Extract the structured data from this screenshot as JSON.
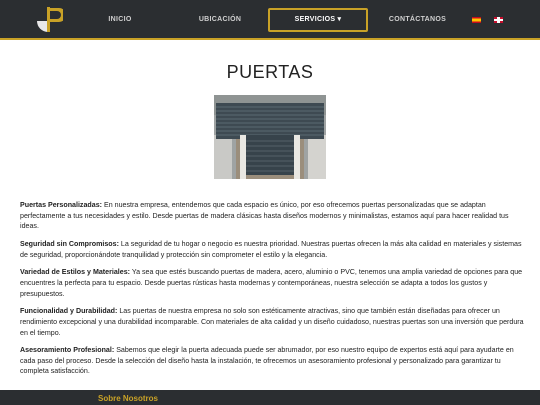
{
  "nav": {
    "inicio": "INICIO",
    "ubicacion": "UBICACIÓN",
    "servicios": "SERVICIOS ▾",
    "contactanos": "CONTÁCTANOS"
  },
  "page": {
    "title": "PUERTAS"
  },
  "sections": [
    {
      "heading": "Puertas Personalizadas:",
      "text": " En nuestra empresa, entendemos que cada espacio es único, por eso ofrecemos puertas personalizadas que se adaptan perfectamente a tus necesidades y estilo. Desde puertas de madera clásicas hasta diseños modernos y minimalistas, estamos aquí para hacer realidad tus ideas."
    },
    {
      "heading": "Seguridad sin Compromisos:",
      "text": " La seguridad de tu hogar o negocio es nuestra prioridad. Nuestras puertas ofrecen la más alta calidad en materiales y sistemas de seguridad, proporcionándote tranquilidad y protección sin comprometer el estilo y la elegancia."
    },
    {
      "heading": "Variedad de Estilos y Materiales:",
      "text": " Ya sea que estés buscando puertas de madera, acero, aluminio o PVC, tenemos una amplia variedad de opciones para que encuentres la perfecta para tu espacio. Desde puertas rústicas hasta modernas y contemporáneas, nuestra selección se adapta a todos los gustos y presupuestos."
    },
    {
      "heading": "Funcionalidad y Durabilidad:",
      "text": " Las puertas de nuestra empresa no solo son estéticamente atractivas, sino que también están diseñadas para ofrecer un rendimiento excepcional y una durabilidad incomparable. Con materiales de alta calidad y un diseño cuidadoso, nuestras puertas son una inversión que perdura en el tiempo."
    },
    {
      "heading": "Asesoramiento Profesional:",
      "text": " Sabemos que elegir la puerta adecuada puede ser abrumador, por eso nuestro equipo de expertos está aquí para ayudarte en cada paso del proceso. Desde la selección del diseño hasta la instalación, te ofrecemos un asesoramiento profesional y personalizado para garantizar tu completa satisfacción."
    }
  ],
  "footer": {
    "title": "Sobre Nosotros"
  },
  "colors": {
    "navbar": "#2b2e31",
    "accent": "#c9a227"
  },
  "icons": {
    "logo": "logo-icon",
    "flag_es": "flag-spain-icon",
    "flag_en": "flag-uk-icon"
  }
}
